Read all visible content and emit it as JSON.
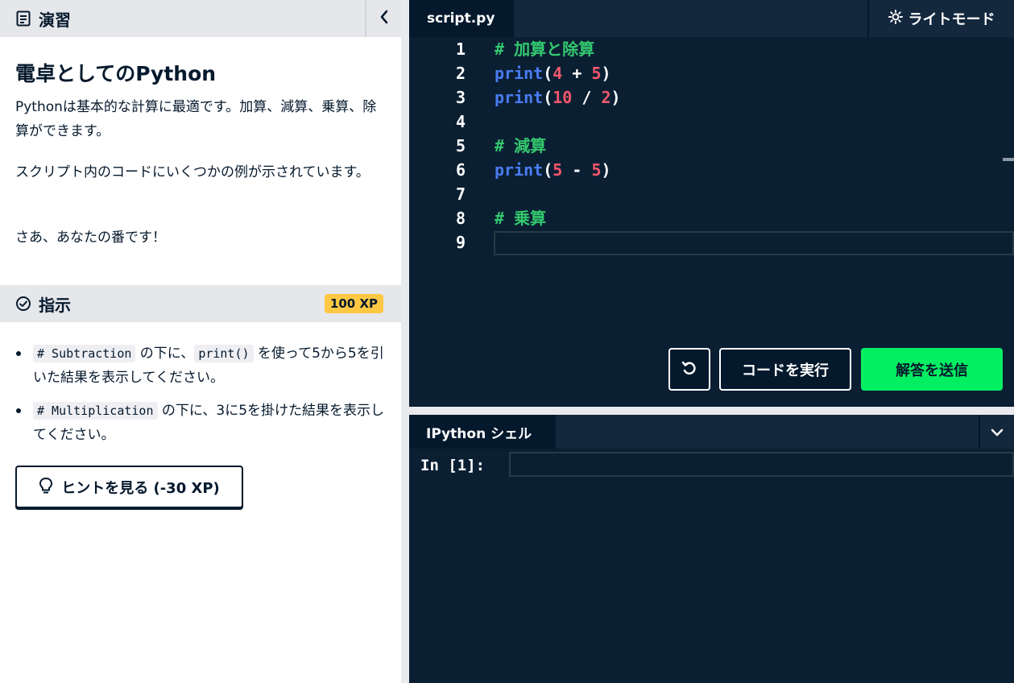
{
  "exercise": {
    "header_title": "演習",
    "title": "電卓としてのPython",
    "para1": "Pythonは基本的な計算に最適です。加算、減算、乗算、除算ができます。",
    "para2": "スクリプト内のコードにいくつかの例が示されています。",
    "para3": "さあ、あなたの番です！"
  },
  "instructions": {
    "header_title": "指示",
    "xp_badge": "100 XP",
    "items": [
      {
        "code": "# Subtraction",
        "text1": " の下に、",
        "code2": "print()",
        "text2": " を使って5から5を引いた結果を表示してください。"
      },
      {
        "code": "# Multiplication",
        "text1": " の下に、3に5を掛けた結果を表示してください。"
      }
    ],
    "hint_label": "ヒントを見る (-30 XP)"
  },
  "editor": {
    "tab_label": "script.py",
    "light_mode_label": "ライトモード",
    "lines": [
      {
        "n": "1",
        "comment": "# 加算と除算"
      },
      {
        "n": "2",
        "fn": "print",
        "open": "(",
        "a": "4",
        "op": " + ",
        "b": "5",
        "close": ")"
      },
      {
        "n": "3",
        "fn": "print",
        "open": "(",
        "a": "10",
        "op": " / ",
        "b": "2",
        "close": ")"
      },
      {
        "n": "4"
      },
      {
        "n": "5",
        "comment": "# 減算"
      },
      {
        "n": "6",
        "fn": "print",
        "open": "(",
        "a": "5",
        "op": " - ",
        "b": "5",
        "close": ")"
      },
      {
        "n": "7"
      },
      {
        "n": "8",
        "comment": "# 乗算"
      },
      {
        "n": "9"
      }
    ],
    "run_label": "コードを実行",
    "submit_label": "解答を送信"
  },
  "shell": {
    "tab_label": "IPython シェル",
    "prompt": "In [1]:"
  },
  "colors": {
    "accent_green": "#03ef62",
    "xp_yellow": "#ffc844",
    "editor_bg": "#0b1f33",
    "comment_green": "#33c86e",
    "function_blue": "#4a7cf0",
    "number_red": "#f2576c"
  },
  "icons": [
    "list-icon",
    "chevron-left-icon",
    "check-circle-icon",
    "lightbulb-icon",
    "sun-icon",
    "reset-icon",
    "chevron-down-icon"
  ]
}
